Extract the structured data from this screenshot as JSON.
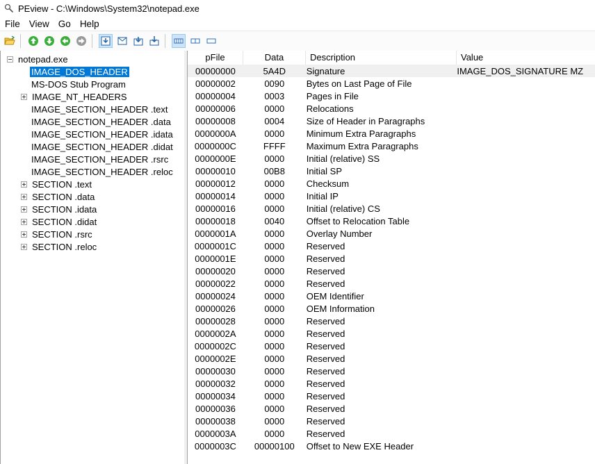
{
  "window": {
    "title": "PEview - C:\\Windows\\System32\\notepad.exe",
    "icon": "peview-magnifier-icon"
  },
  "menu": [
    "File",
    "View",
    "Go",
    "Help"
  ],
  "toolbar": {
    "icons": [
      "open-folder-icon",
      "arrow-up-icon",
      "arrow-down-icon",
      "arrow-back-icon",
      "arrow-forward-icon",
      "view-save-icon",
      "view-mail-icon",
      "view-down-icon",
      "view-import-icon",
      "view-byte-icon",
      "view-word-icon",
      "view-dword-icon"
    ],
    "accent": "#0078d7"
  },
  "tree": {
    "root": "notepad.exe",
    "items": [
      {
        "label": "IMAGE_DOS_HEADER",
        "selected": true,
        "expandable": false
      },
      {
        "label": "MS-DOS Stub Program",
        "expandable": false
      },
      {
        "label": "IMAGE_NT_HEADERS",
        "expandable": true
      },
      {
        "label": "IMAGE_SECTION_HEADER .text",
        "expandable": false
      },
      {
        "label": "IMAGE_SECTION_HEADER .data",
        "expandable": false
      },
      {
        "label": "IMAGE_SECTION_HEADER .idata",
        "expandable": false
      },
      {
        "label": "IMAGE_SECTION_HEADER .didat",
        "expandable": false
      },
      {
        "label": "IMAGE_SECTION_HEADER .rsrc",
        "expandable": false
      },
      {
        "label": "IMAGE_SECTION_HEADER .reloc",
        "expandable": false
      },
      {
        "label": "SECTION .text",
        "expandable": true
      },
      {
        "label": "SECTION .data",
        "expandable": true
      },
      {
        "label": "SECTION .idata",
        "expandable": true
      },
      {
        "label": "SECTION .didat",
        "expandable": true
      },
      {
        "label": "SECTION .rsrc",
        "expandable": true
      },
      {
        "label": "SECTION .reloc",
        "expandable": true
      }
    ]
  },
  "table": {
    "columns": [
      "pFile",
      "Data",
      "Description",
      "Value"
    ],
    "rows": [
      {
        "pfile": "00000000",
        "data": "5A4D",
        "desc": "Signature",
        "value": "IMAGE_DOS_SIGNATURE  MZ"
      },
      {
        "pfile": "00000002",
        "data": "0090",
        "desc": "Bytes on Last Page of File",
        "value": ""
      },
      {
        "pfile": "00000004",
        "data": "0003",
        "desc": "Pages in File",
        "value": ""
      },
      {
        "pfile": "00000006",
        "data": "0000",
        "desc": "Relocations",
        "value": ""
      },
      {
        "pfile": "00000008",
        "data": "0004",
        "desc": "Size of Header in Paragraphs",
        "value": ""
      },
      {
        "pfile": "0000000A",
        "data": "0000",
        "desc": "Minimum Extra Paragraphs",
        "value": ""
      },
      {
        "pfile": "0000000C",
        "data": "FFFF",
        "desc": "Maximum Extra Paragraphs",
        "value": ""
      },
      {
        "pfile": "0000000E",
        "data": "0000",
        "desc": "Initial (relative) SS",
        "value": ""
      },
      {
        "pfile": "00000010",
        "data": "00B8",
        "desc": "Initial SP",
        "value": ""
      },
      {
        "pfile": "00000012",
        "data": "0000",
        "desc": "Checksum",
        "value": ""
      },
      {
        "pfile": "00000014",
        "data": "0000",
        "desc": "Initial IP",
        "value": ""
      },
      {
        "pfile": "00000016",
        "data": "0000",
        "desc": "Initial (relative) CS",
        "value": ""
      },
      {
        "pfile": "00000018",
        "data": "0040",
        "desc": "Offset to Relocation Table",
        "value": ""
      },
      {
        "pfile": "0000001A",
        "data": "0000",
        "desc": "Overlay Number",
        "value": ""
      },
      {
        "pfile": "0000001C",
        "data": "0000",
        "desc": "Reserved",
        "value": ""
      },
      {
        "pfile": "0000001E",
        "data": "0000",
        "desc": "Reserved",
        "value": ""
      },
      {
        "pfile": "00000020",
        "data": "0000",
        "desc": "Reserved",
        "value": ""
      },
      {
        "pfile": "00000022",
        "data": "0000",
        "desc": "Reserved",
        "value": ""
      },
      {
        "pfile": "00000024",
        "data": "0000",
        "desc": "OEM Identifier",
        "value": ""
      },
      {
        "pfile": "00000026",
        "data": "0000",
        "desc": "OEM Information",
        "value": ""
      },
      {
        "pfile": "00000028",
        "data": "0000",
        "desc": "Reserved",
        "value": ""
      },
      {
        "pfile": "0000002A",
        "data": "0000",
        "desc": "Reserved",
        "value": ""
      },
      {
        "pfile": "0000002C",
        "data": "0000",
        "desc": "Reserved",
        "value": ""
      },
      {
        "pfile": "0000002E",
        "data": "0000",
        "desc": "Reserved",
        "value": ""
      },
      {
        "pfile": "00000030",
        "data": "0000",
        "desc": "Reserved",
        "value": ""
      },
      {
        "pfile": "00000032",
        "data": "0000",
        "desc": "Reserved",
        "value": ""
      },
      {
        "pfile": "00000034",
        "data": "0000",
        "desc": "Reserved",
        "value": ""
      },
      {
        "pfile": "00000036",
        "data": "0000",
        "desc": "Reserved",
        "value": ""
      },
      {
        "pfile": "00000038",
        "data": "0000",
        "desc": "Reserved",
        "value": ""
      },
      {
        "pfile": "0000003A",
        "data": "0000",
        "desc": "Reserved",
        "value": ""
      },
      {
        "pfile": "0000003C",
        "data": "00000100",
        "desc": "Offset to New EXE Header",
        "value": ""
      }
    ]
  }
}
